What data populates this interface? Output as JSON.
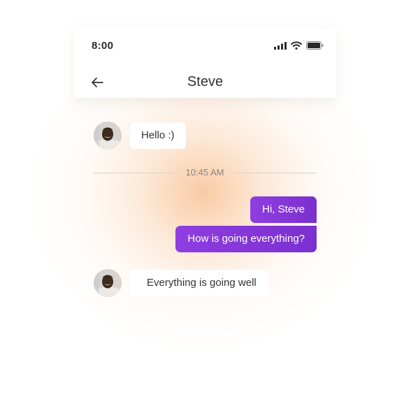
{
  "status_bar": {
    "time": "8:00",
    "icons": [
      "signal-icon",
      "wifi-icon",
      "battery-icon"
    ]
  },
  "header": {
    "back_icon": "arrow-left-icon",
    "title": "Steve"
  },
  "messages": [
    {
      "direction": "incoming",
      "text": "Hello :)"
    },
    {
      "direction": "divider",
      "text": "10:45 AM"
    },
    {
      "direction": "outgoing",
      "text": "Hi, Steve"
    },
    {
      "direction": "outgoing",
      "text": "How is going everything?"
    },
    {
      "direction": "incoming",
      "text": "Everything is going well"
    }
  ],
  "colors": {
    "outgoing_bubble_start": "#8f3ee0",
    "outgoing_bubble_end": "#7b2fcf",
    "incoming_bubble": "#ffffff",
    "background_glow": "#f9c8a0"
  }
}
